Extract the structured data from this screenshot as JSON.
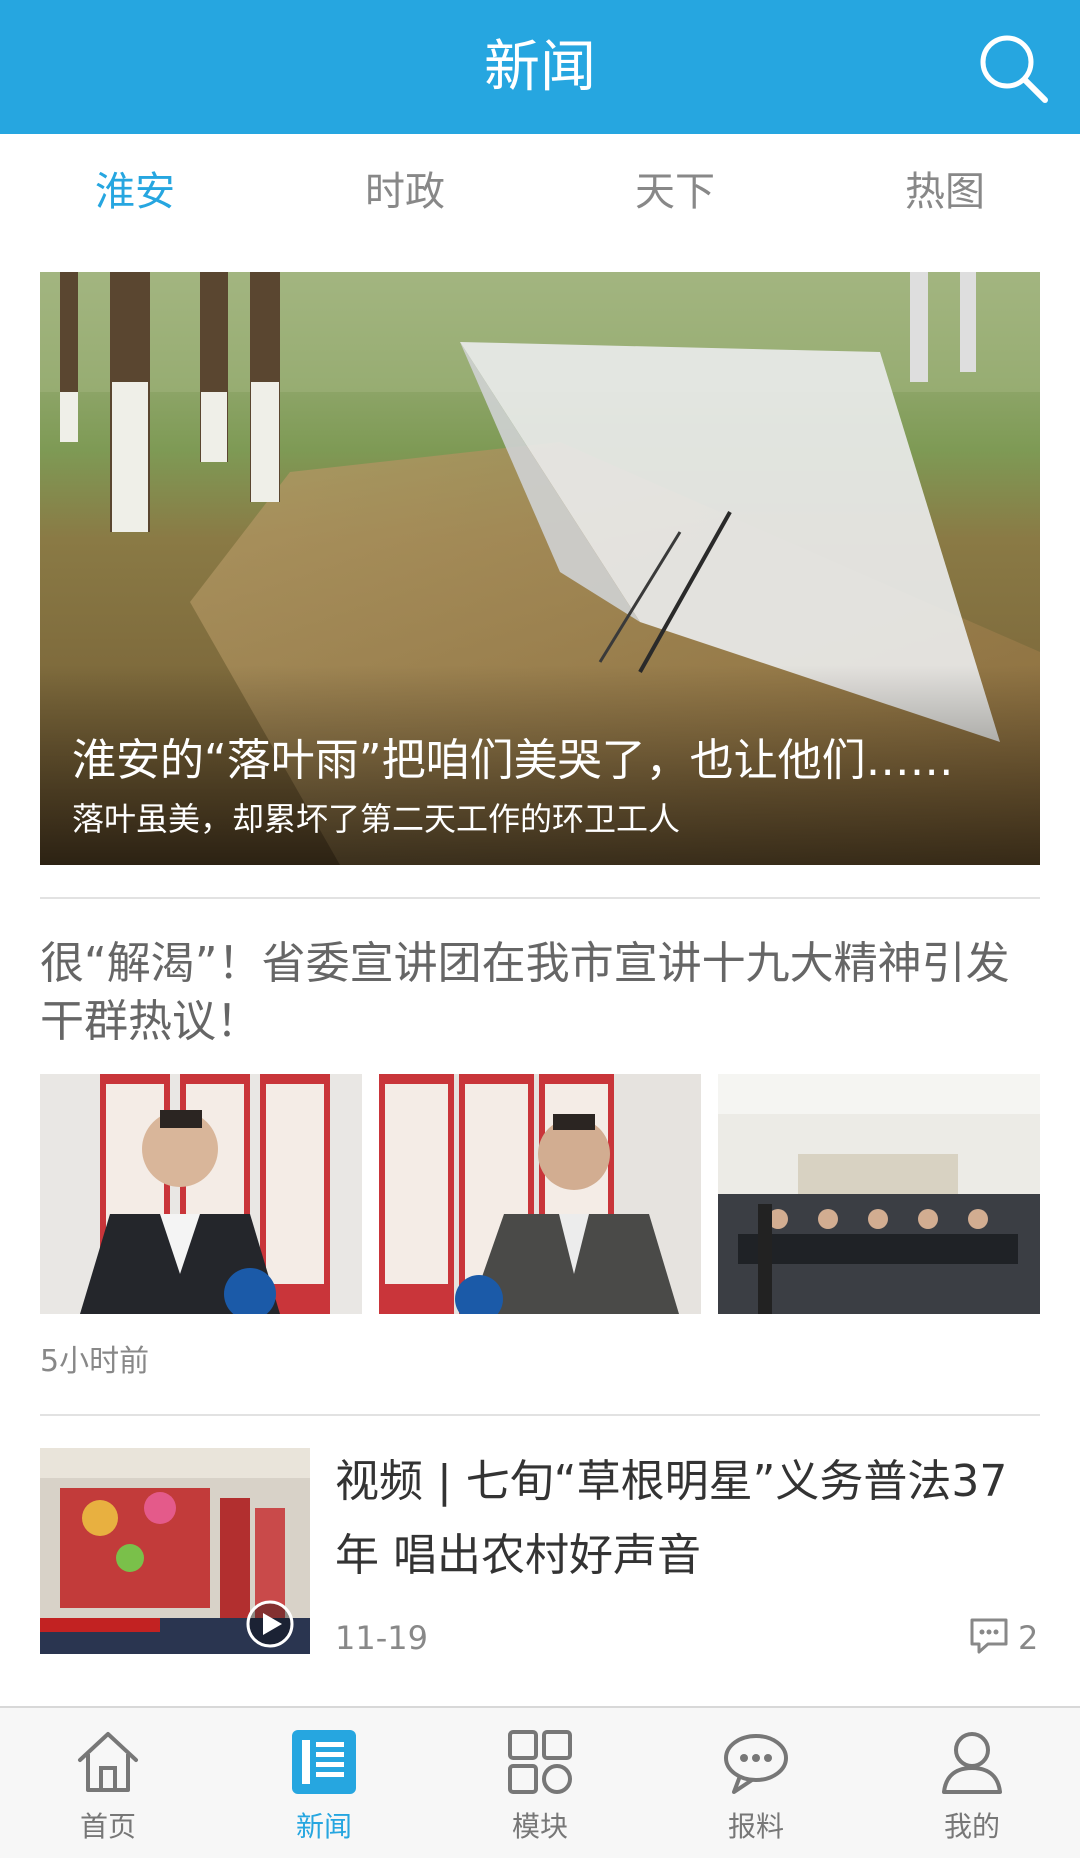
{
  "header": {
    "title": "新闻",
    "search_icon": "search-icon"
  },
  "tabs": [
    {
      "label": "淮安",
      "active": true
    },
    {
      "label": "时政",
      "active": false
    },
    {
      "label": "天下",
      "active": false
    },
    {
      "label": "热图",
      "active": false
    }
  ],
  "hero": {
    "title": "淮安的“落叶雨”把咱们美哭了，也让他们……",
    "subtitle": "落叶虽美，却累坏了第二天工作的环卫工人"
  },
  "article1": {
    "title": "很“解渴”！省委宣讲团在我市宣讲十九大精神引发干群热议！",
    "time": "5小时前"
  },
  "article2": {
    "title": "视频 | 七旬“草根明星”义务普法37年  唱出农村好声音",
    "date": "11-19",
    "comments": "2"
  },
  "bottom_nav": [
    {
      "label": "首页",
      "icon": "home-icon",
      "active": false
    },
    {
      "label": "新闻",
      "icon": "news-icon",
      "active": true
    },
    {
      "label": "模块",
      "icon": "modules-grid-icon",
      "active": false
    },
    {
      "label": "报料",
      "icon": "chat-bubble-icon",
      "active": false
    },
    {
      "label": "我的",
      "icon": "user-icon",
      "active": false
    }
  ],
  "colors": {
    "accent": "#26a6e0",
    "inactive": "#888888"
  }
}
